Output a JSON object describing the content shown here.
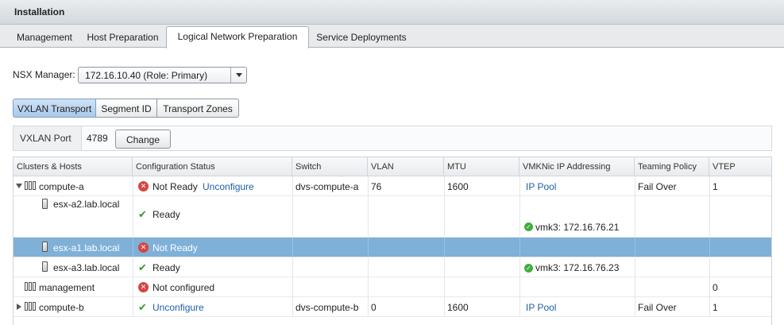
{
  "title": "Installation",
  "tabs": [
    {
      "label": "Management"
    },
    {
      "label": "Host Preparation"
    },
    {
      "label": "Logical Network Preparation"
    },
    {
      "label": "Service Deployments"
    }
  ],
  "nsx_manager": {
    "label": "NSX Manager:",
    "value": "172.16.10.40 (Role: Primary)"
  },
  "segments": [
    {
      "label": "VXLAN Transport"
    },
    {
      "label": "Segment ID"
    },
    {
      "label": "Transport Zones"
    }
  ],
  "vxlan_port": {
    "label": "VXLAN Port",
    "value": "4789",
    "button": "Change"
  },
  "table": {
    "headers": [
      "Clusters & Hosts",
      "Configuration Status",
      "Switch",
      "VLAN",
      "MTU",
      "VMKNic IP Addressing",
      "Teaming Policy",
      "VTEP"
    ],
    "rows": [
      {
        "name": "compute-a",
        "status": "Not Ready",
        "action": "Unconfigure",
        "switch": "dvs-compute-a",
        "vlan": "76",
        "mtu": "1600",
        "ip": "IP Pool",
        "teaming": "Fail Over",
        "vtep": "1"
      },
      {
        "name": "esx-a2.lab.local",
        "status": "Ready",
        "vmk": "vmk3: 172.16.76.21"
      },
      {
        "name": "esx-a1.lab.local",
        "status": "Not Ready"
      },
      {
        "name": "esx-a3.lab.local",
        "status": "Ready",
        "vmk": "vmk3: 172.16.76.23"
      },
      {
        "name": "management",
        "status": "Not configured",
        "vtep": "0"
      },
      {
        "name": "compute-b",
        "action": "Unconfigure",
        "switch": "dvs-compute-b",
        "vlan": "0",
        "mtu": "1600",
        "ip": "IP Pool",
        "teaming": "Fail Over",
        "vtep": "1"
      }
    ]
  },
  "colors": {
    "selected_row": "#7fb0d8",
    "link": "#1f5fa8",
    "error": "#d64541",
    "ok": "#3a9a2c"
  }
}
